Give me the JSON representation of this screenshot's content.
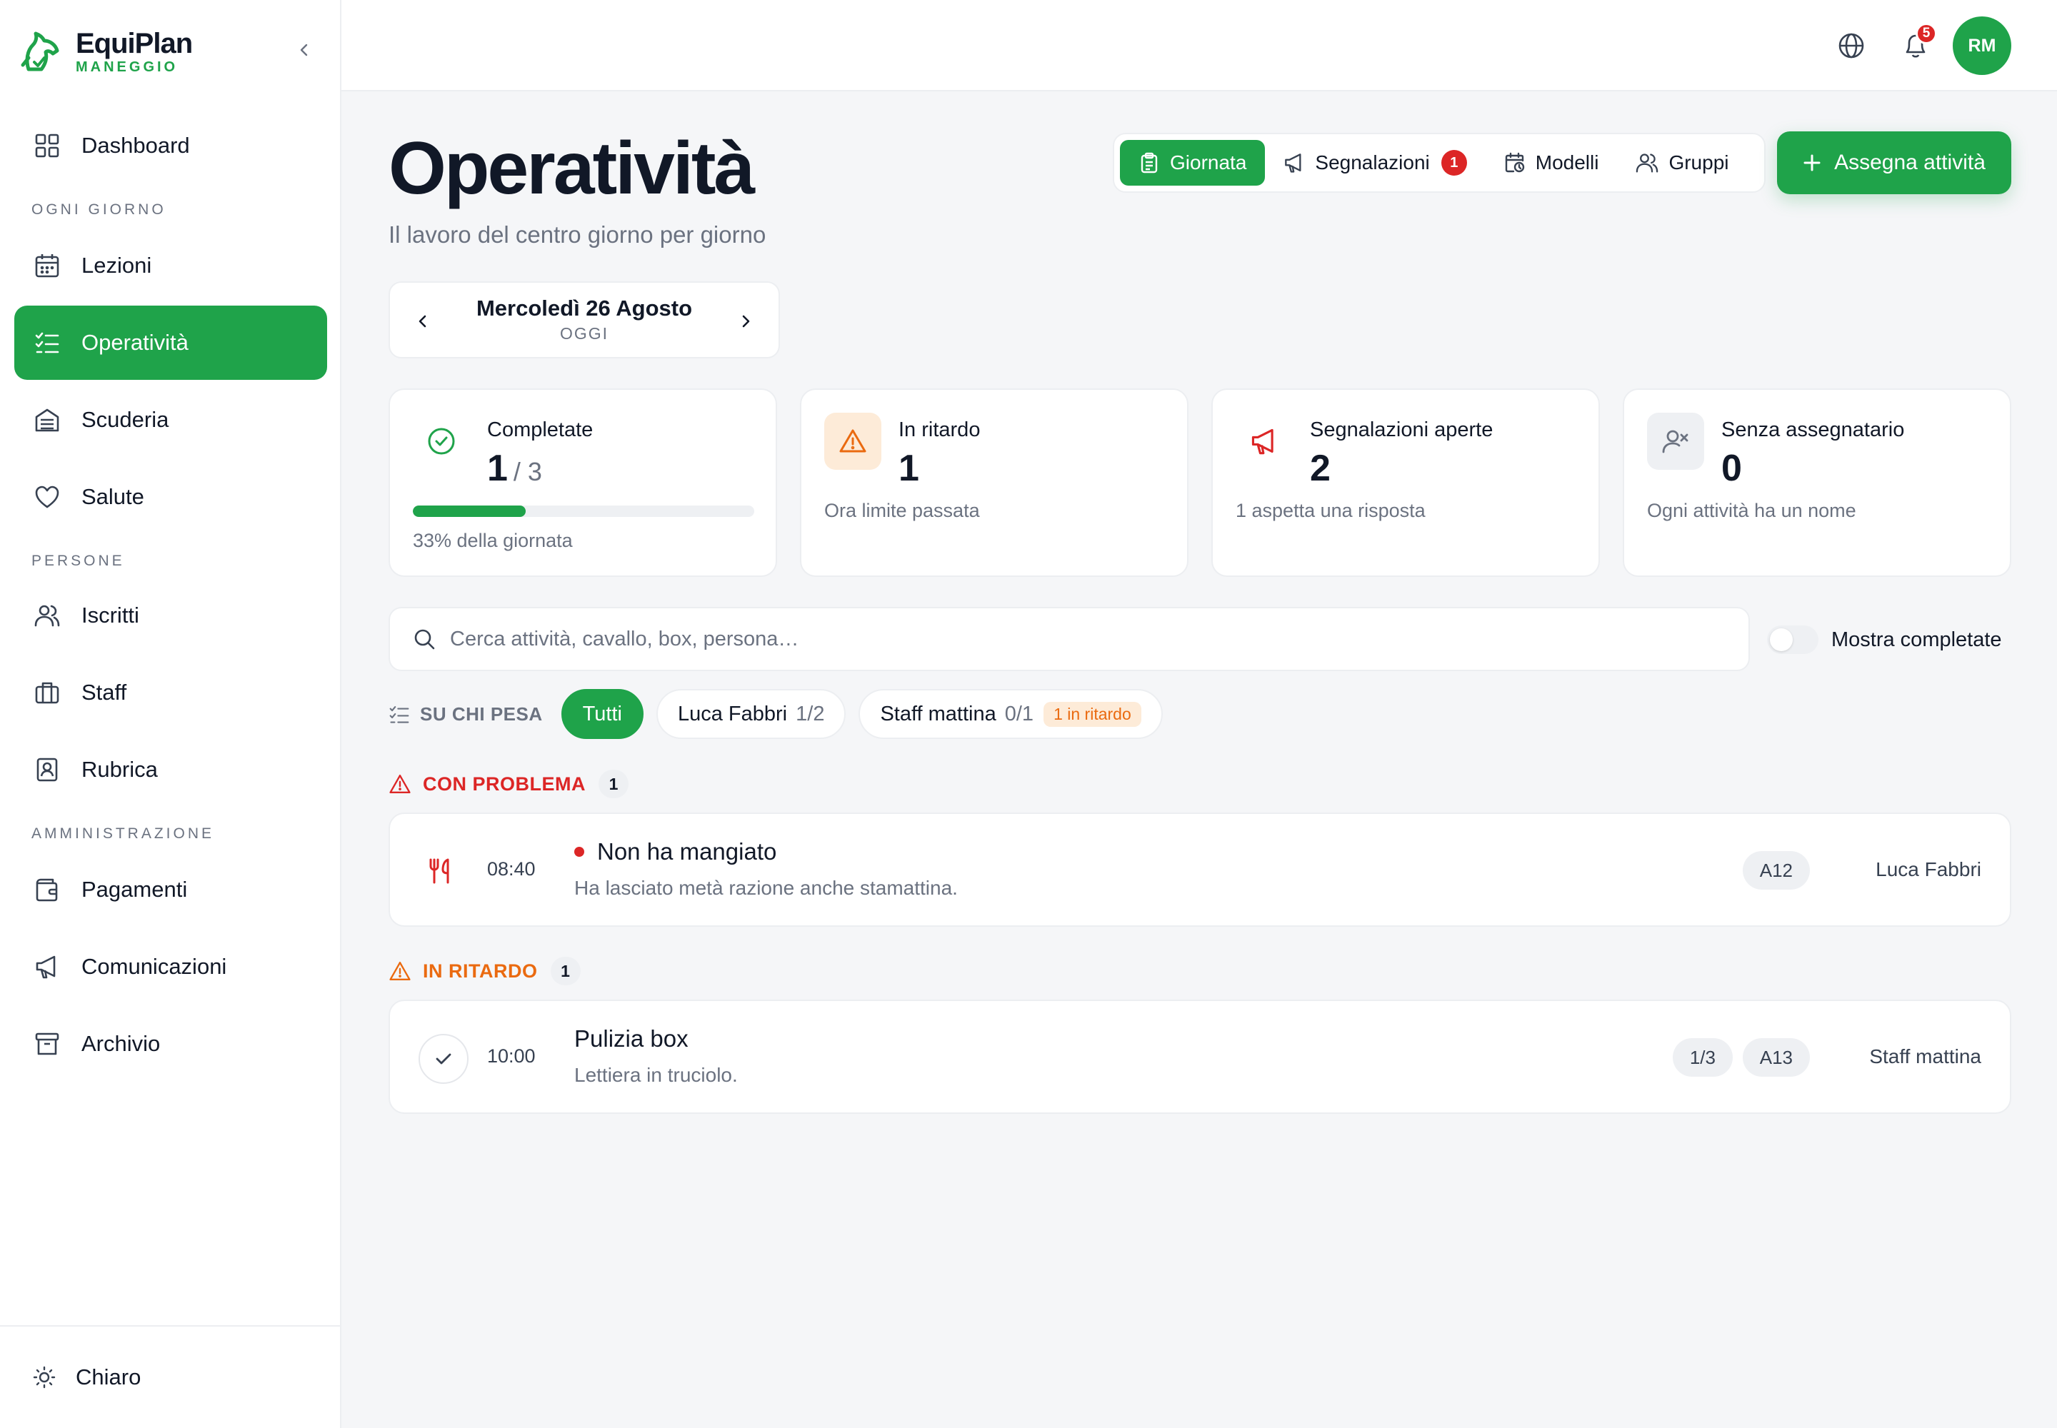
{
  "brand": {
    "name": "EquiPlan",
    "sub": "MANEGGIO"
  },
  "nav": {
    "dashboard": "Dashboard",
    "section_daily": "OGNI GIORNO",
    "lezioni": "Lezioni",
    "operativita": "Operatività",
    "scuderia": "Scuderia",
    "salute": "Salute",
    "section_people": "PERSONE",
    "iscritti": "Iscritti",
    "staff": "Staff",
    "rubrica": "Rubrica",
    "section_admin": "AMMINISTRAZIONE",
    "pagamenti": "Pagamenti",
    "comunicazioni": "Comunicazioni",
    "archivio": "Archivio",
    "theme": "Chiaro"
  },
  "topbar": {
    "notifications_count": "5",
    "avatar_initials": "RM"
  },
  "page": {
    "title": "Operatività",
    "subtitle": "Il lavoro del centro giorno per giorno"
  },
  "tabs": {
    "giornata": "Giornata",
    "segnalazioni": "Segnalazioni",
    "segnalazioni_badge": "1",
    "modelli": "Modelli",
    "gruppi": "Gruppi"
  },
  "assign_button": "Assegna attività",
  "date_nav": {
    "date": "Mercoledì 26 Agosto",
    "label": "OGGI"
  },
  "stats": {
    "completed": {
      "label": "Completate",
      "value": "1",
      "of": "/ 3",
      "note": "33% della giornata",
      "progress": 0.33
    },
    "late": {
      "label": "In ritardo",
      "value": "1",
      "note": "Ora limite passata"
    },
    "reports": {
      "label": "Segnalazioni aperte",
      "value": "2",
      "note": "1 aspetta una risposta"
    },
    "unassigned": {
      "label": "Senza assegnatario",
      "value": "0",
      "note": "Ogni attività ha un nome"
    }
  },
  "search": {
    "placeholder": "Cerca attività, cavallo, box, persona…",
    "value": ""
  },
  "show_completed": "Mostra completate",
  "filters": {
    "title": "SU CHI PESA",
    "all": "Tutti",
    "luca": {
      "name": "Luca Fabbri",
      "count": "1/2"
    },
    "staff": {
      "name": "Staff mattina",
      "count": "0/1",
      "late": "1 in ritardo"
    }
  },
  "groups": {
    "problem": {
      "label": "CON PROBLEMA",
      "count": "1"
    },
    "late": {
      "label": "IN RITARDO",
      "count": "1"
    }
  },
  "tasks": {
    "problem": {
      "time": "08:40",
      "title": "Non ha mangiato",
      "desc": "Ha lasciato metà razione anche stamattina.",
      "box": "A12",
      "owner": "Luca Fabbri"
    },
    "late": {
      "time": "10:00",
      "title": "Pulizia box",
      "desc": "Lettiera in truciolo.",
      "progress": "1/3",
      "box": "A13",
      "owner": "Staff mattina"
    }
  },
  "colors": {
    "accent": "#1fa34a",
    "danger": "#dc2626",
    "warning": "#ea6a10",
    "muted": "#6b7280"
  }
}
